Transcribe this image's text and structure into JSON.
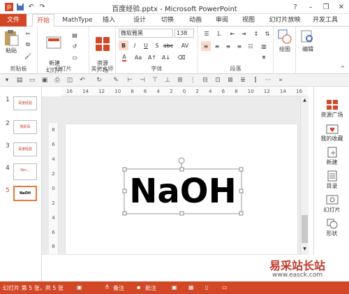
{
  "window": {
    "title": "百度经验.pptx - Microsoft PowerPoint",
    "help": "?",
    "min": "–",
    "restore": "❐",
    "close": "✕"
  },
  "tabs": [
    "文件",
    "开始",
    "MathType",
    "插入",
    "设计",
    "切换",
    "动画",
    "审阅",
    "视图",
    "幻灯片放映",
    "开发工具"
  ],
  "ribbon": {
    "clipboard": {
      "label": "剪贴板",
      "paste": "粘贴"
    },
    "slides": {
      "label": "幻灯片",
      "new_slide": "新建\n幻灯片"
    },
    "beautify": {
      "label": "美化大师",
      "resources": "资源\n广场"
    },
    "font": {
      "label": "字体",
      "font_name": "微软雅黑",
      "font_size": "138"
    },
    "paragraph": {
      "label": "段落"
    },
    "drawing": {
      "label": "绘图"
    },
    "editing": {
      "label": "编辑"
    }
  },
  "ruler": {
    "horizontal": [
      "16",
      "14",
      "12",
      "10",
      "8",
      "6",
      "4",
      "2",
      "0",
      "2",
      "4",
      "6",
      "8",
      "10",
      "12",
      "14",
      "16"
    ],
    "vertical": [
      "8",
      "6",
      "4",
      "2",
      "0",
      "2",
      "4",
      "6",
      "8"
    ]
  },
  "slides": [
    {
      "num": "1",
      "text": "百度经验"
    },
    {
      "num": "2",
      "text": "我的百"
    },
    {
      "num": "3",
      "text": "百度经验"
    },
    {
      "num": "4",
      "text": "Nm..."
    },
    {
      "num": "5",
      "text": "NaOH"
    }
  ],
  "slide_content": {
    "text": "NaOH"
  },
  "right_panel": [
    "资源广场",
    "我的收藏",
    "新建",
    "目录",
    "幻灯片",
    "形状"
  ],
  "status": {
    "slide_info": "幻灯片 第 5 张，共 5 张",
    "notes": "备注",
    "comments": "批注"
  },
  "watermark": {
    "title": "易采站长站",
    "url": "www.easck.com"
  },
  "colors": {
    "accent": "#d24726",
    "active_tab": "#d24726"
  }
}
